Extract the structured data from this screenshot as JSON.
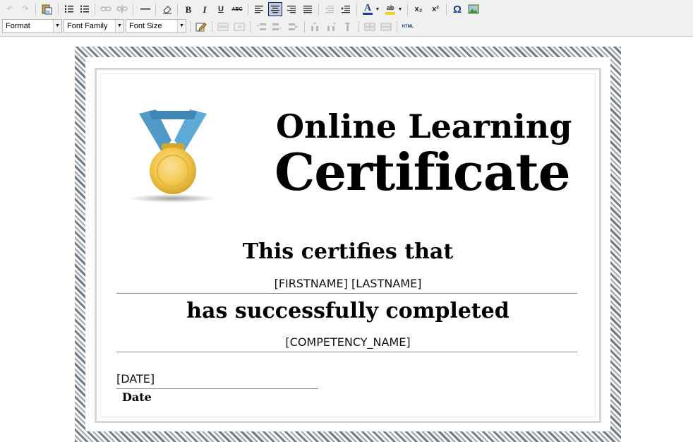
{
  "toolbar": {
    "format_label": "Format",
    "font_family_label": "Font Family",
    "font_size_label": "Font Size",
    "bold_label": "B",
    "italic_label": "I",
    "underline_label": "U",
    "strike_label": "ABC",
    "subscript_label": "x₂",
    "superscript_label": "x²",
    "omega_label": "Ω",
    "html_label": "HTML"
  },
  "certificate": {
    "title_line1": "Online Learning",
    "title_line2": "Certificate",
    "certifies": "This certifies that",
    "name_placeholder": "[FIRSTNAME] [LASTNAME]",
    "completed": "has successfully completed",
    "competency_placeholder": "[COMPETENCY_NAME]",
    "date_placeholder": "[DATE]",
    "date_label": "Date"
  }
}
